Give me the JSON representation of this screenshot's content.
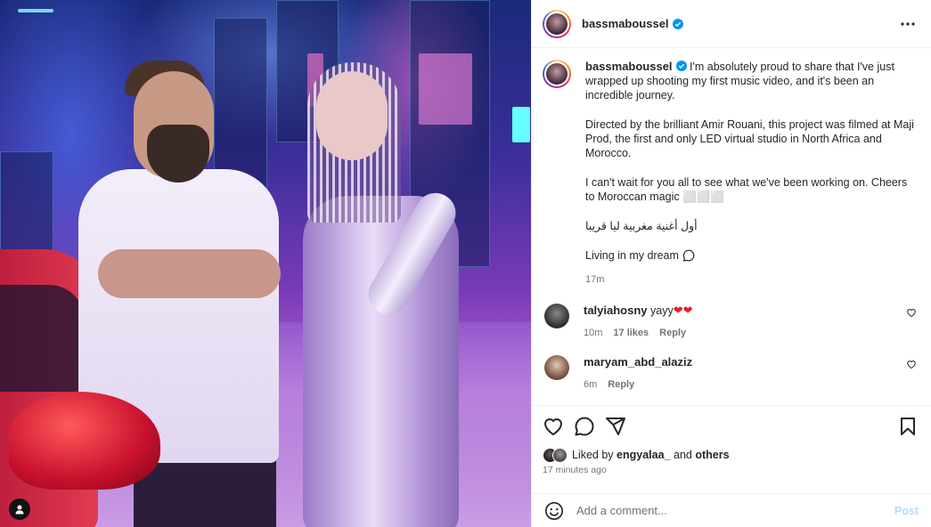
{
  "post": {
    "author": "bassmaboussel",
    "verified": true
  },
  "caption": {
    "author": "bassmaboussel",
    "paragraph1": "I'm absolutely proud to share that I've just wrapped up shooting my first music video, and it's been an incredible journey.",
    "paragraph2": "Directed by the brilliant Amir Rouani, this project was filmed at Maji Prod, the first and only LED virtual studio in North Africa and Morocco.",
    "paragraph3": "I can't wait for you all to see what we've been working on. Cheers to Moroccan magic ⬜⬜⬜",
    "arabic": "أول أغنية مغربية ليا قريبا",
    "living": "Living in my dream",
    "time": "17m"
  },
  "comments": [
    {
      "user": "talyiahosny",
      "text": "yayy",
      "hearts": "❤❤",
      "time": "10m",
      "likes": "17 likes",
      "reply": "Reply"
    },
    {
      "user": "maryam_abd_alaziz",
      "text": "",
      "hearts": "",
      "time": "6m",
      "likes": "",
      "reply": "Reply"
    }
  ],
  "liked": {
    "prefix": "Liked by",
    "user": "engyalaa_",
    "and": "and",
    "others": "others"
  },
  "posted_ago": "17 minutes ago",
  "add_comment": {
    "placeholder": "Add a comment...",
    "post_label": "Post"
  },
  "colors": {
    "verified": "#0095f6",
    "post_disabled": "#b3dbff",
    "heart": "#ed1c24"
  }
}
